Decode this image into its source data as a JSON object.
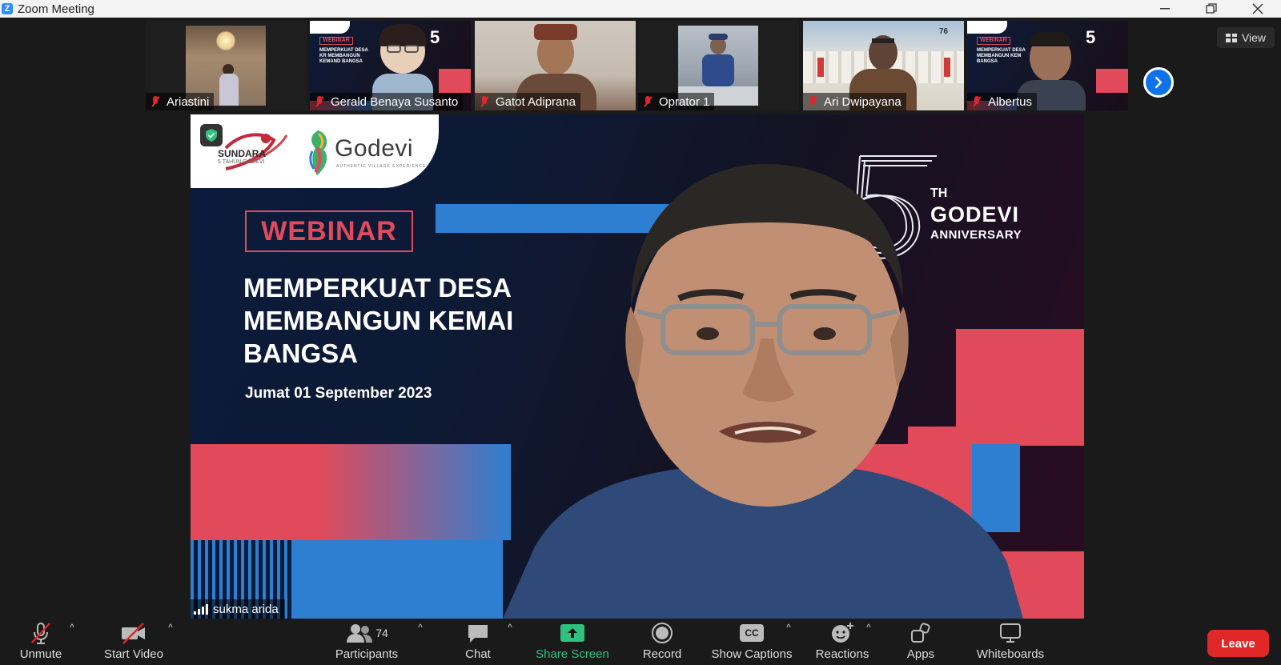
{
  "window": {
    "title": "Zoom Meeting",
    "app_icon": "Z"
  },
  "gallery": {
    "participants": [
      {
        "name": "Ariastini",
        "muted": true
      },
      {
        "name": "Gerald Benaya Susanto",
        "muted": true
      },
      {
        "name": "Gatot Adiprana",
        "muted": true
      },
      {
        "name": "Oprator 1",
        "muted": true
      },
      {
        "name": "Ari Dwipayana",
        "muted": true
      },
      {
        "name": "Albertus",
        "muted": true
      }
    ],
    "view_label": "View"
  },
  "speaker": {
    "name": "sukma arida",
    "slide": {
      "logo_left": "SUNDARA",
      "logo_left_sub": "5 TAHUN GODEVI",
      "logo_right": "Godevi",
      "logo_right_sub": "AUTHENTIC VILLAGE EXPERIENCE",
      "badge": "WEBINAR",
      "title": "MEMPERKUAT DESA\nMEMBANGUN KEMAI\nBANGSA",
      "date": "Jumat  01 September 2023",
      "anniv_th": "TH",
      "anniv_brand": "GODEVI",
      "anniv_word": "ANNIVERSARY"
    }
  },
  "toolbar": {
    "unmute": "Unmute",
    "start_video": "Start Video",
    "participants": "Participants",
    "participants_count": "74",
    "chat": "Chat",
    "share_screen": "Share Screen",
    "record": "Record",
    "show_captions": "Show Captions",
    "captions_icon": "CC",
    "reactions": "Reactions",
    "apps": "Apps",
    "whiteboards": "Whiteboards",
    "leave": "Leave"
  },
  "colors": {
    "accent_blue": "#0e72ed",
    "muted_red": "#e0262b",
    "share_green": "#2ec27e",
    "leave_red": "#e02828",
    "slide_red": "#e04a5a",
    "slide_blue": "#2e7fd1"
  }
}
